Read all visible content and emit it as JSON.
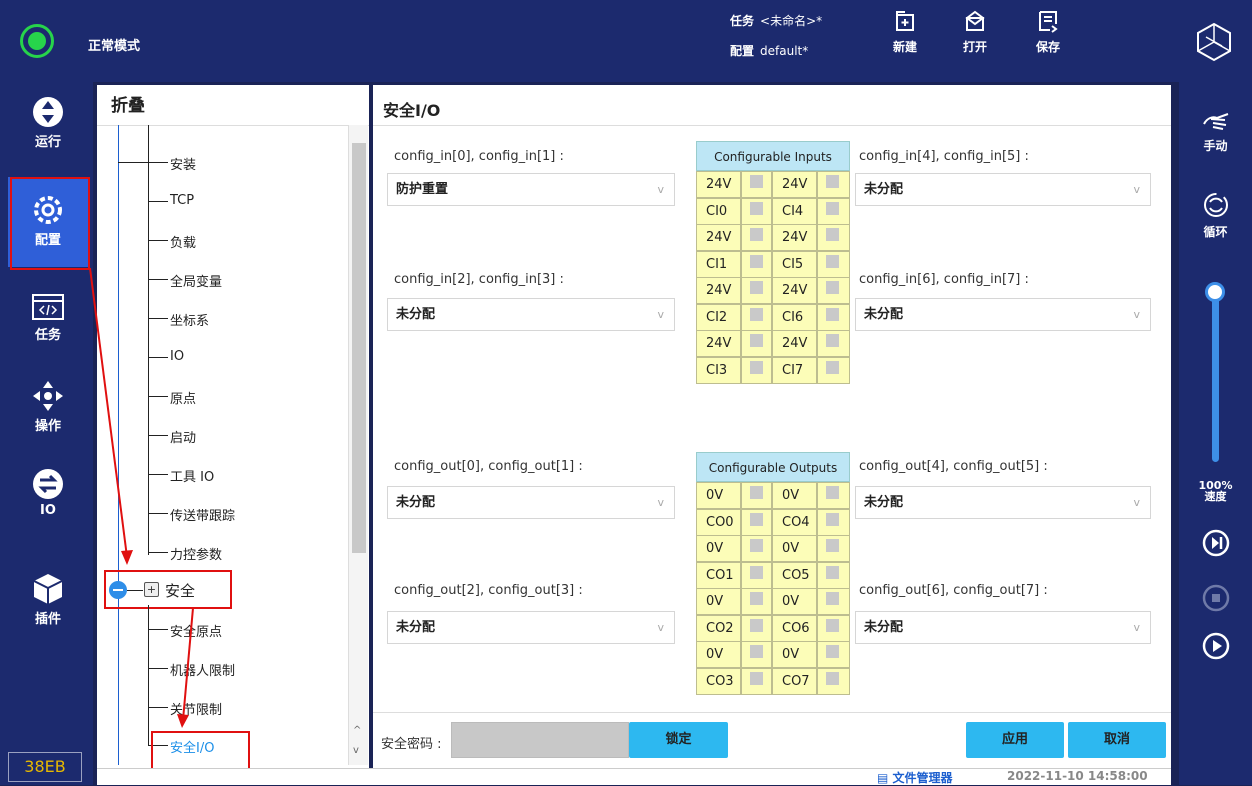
{
  "topbar": {
    "mode": "正常模式",
    "task_label": "任务",
    "task_value": "<未命名>*",
    "config_label": "配置",
    "config_value": "default*",
    "new_label": "新建",
    "open_label": "打开",
    "save_label": "保存"
  },
  "leftnav": {
    "run": "运行",
    "config": "配置",
    "task": "任务",
    "operate": "操作",
    "io": "IO",
    "plugin": "插件",
    "badge": "38EB"
  },
  "rightnav": {
    "manual": "手动",
    "loop": "循环",
    "speed_value": "100%",
    "speed_label": "速度",
    "speed_fraction": 1.0
  },
  "tree": {
    "title": "折叠",
    "items": [
      "安装",
      "TCP",
      "负载",
      "全局变量",
      "坐标系",
      "IO",
      "原点",
      "启动",
      "工具 IO",
      "传送带跟踪",
      "力控参数"
    ],
    "safety": "安全",
    "safety_children": [
      "安全原点",
      "机器人限制",
      "关节限制",
      "安全I/O"
    ]
  },
  "main": {
    "title": "安全I/O",
    "inputs_header": "Configurable Inputs",
    "outputs_header": "Configurable Outputs",
    "in01_label": "config_in[0], config_in[1] :",
    "in01_value": "防护重置",
    "in23_label": "config_in[2], config_in[3] :",
    "in23_value": "未分配",
    "in45_label": "config_in[4], config_in[5] :",
    "in45_value": "未分配",
    "in67_label": "config_in[6], config_in[7] :",
    "in67_value": "未分配",
    "out01_label": "config_out[0], config_out[1] :",
    "out01_value": "未分配",
    "out23_label": "config_out[2], config_out[3] :",
    "out23_value": "未分配",
    "out45_label": "config_out[4], config_out[5] :",
    "out45_value": "未分配",
    "out67_label": "config_out[6], config_out[7] :",
    "out67_value": "未分配",
    "in_rows": [
      [
        "24V",
        "24V"
      ],
      [
        "CI0",
        "CI4"
      ],
      [
        "24V",
        "24V"
      ],
      [
        "CI1",
        "CI5"
      ],
      [
        "24V",
        "24V"
      ],
      [
        "CI2",
        "CI6"
      ],
      [
        "24V",
        "24V"
      ],
      [
        "CI3",
        "CI7"
      ]
    ],
    "out_rows": [
      [
        "0V",
        "0V"
      ],
      [
        "CO0",
        "CO4"
      ],
      [
        "0V",
        "0V"
      ],
      [
        "CO1",
        "CO5"
      ],
      [
        "0V",
        "0V"
      ],
      [
        "CO2",
        "CO6"
      ],
      [
        "0V",
        "0V"
      ],
      [
        "CO3",
        "CO7"
      ]
    ]
  },
  "bottom": {
    "password_label": "安全密码 :",
    "lock": "锁定",
    "apply": "应用",
    "cancel": "取消"
  },
  "status": {
    "file_manager": "文件管理器",
    "timestamp": "2022-11-10 14:58:00"
  },
  "colors": {
    "nav_bg": "#1c2a6e",
    "accent": "#2db8f0",
    "active": "#2f5fd8",
    "highlight": "#e01010"
  }
}
